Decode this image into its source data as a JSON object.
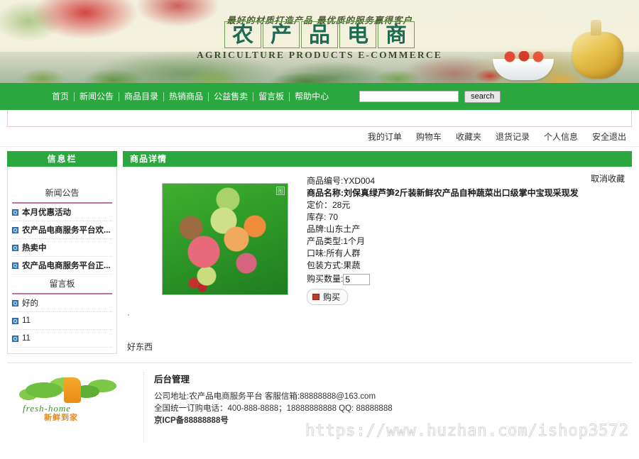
{
  "banner": {
    "slogan": "最好的材质打造产品  最优质的服务赢得客户",
    "title_chars": [
      "农",
      "产",
      "品",
      "电",
      "商"
    ],
    "subtitle": "AGRICULTURE PRODUCTS E-COMMERCE"
  },
  "nav": {
    "items": [
      {
        "label": "首页"
      },
      {
        "label": "新闻公告"
      },
      {
        "label": "商品目录"
      },
      {
        "label": "热销商品"
      },
      {
        "label": "公益售卖"
      },
      {
        "label": "留言板"
      },
      {
        "label": "帮助中心"
      }
    ],
    "search": {
      "value": "",
      "placeholder": "",
      "button_label": "search"
    }
  },
  "usermenu": {
    "items": [
      {
        "label": "我的订单"
      },
      {
        "label": "购物车"
      },
      {
        "label": "收藏夹"
      },
      {
        "label": "退货记录"
      },
      {
        "label": "个人信息"
      },
      {
        "label": "安全退出"
      }
    ]
  },
  "sidebar": {
    "header": "信息栏",
    "sections": [
      {
        "title": "新闻公告",
        "items": [
          {
            "label": "本月优惠活动",
            "icon": "bullet-icon"
          },
          {
            "label": "农产品电商服务平台欢...",
            "icon": "bullet-icon"
          },
          {
            "label": "热卖中",
            "icon": "bullet-icon"
          },
          {
            "label": "农产品电商服务平台正...",
            "icon": "bullet-icon"
          }
        ]
      },
      {
        "title": "留言板",
        "items": [
          {
            "label": "好的",
            "icon": "bullet-icon"
          },
          {
            "label": "11",
            "icon": "bullet-icon"
          },
          {
            "label": "11",
            "icon": "bullet-icon"
          }
        ]
      }
    ]
  },
  "content": {
    "header": "商品详情",
    "favorite_link": "取消收藏",
    "product": {
      "id_line": "商品编号:YXD004",
      "name_line": "商品名称:刘保真绿芦笋2斤装新鲜农产品自种蔬菜出口级掌中宝现采现发",
      "price_line": "定价：28元",
      "stock_line": "库存: 70",
      "brand_line": "品牌:山东土产",
      "type_line": "产品类型:1个月",
      "taste_line": "口味:所有人群",
      "package_line": "包装方式:果蔬",
      "qty_label": "购买数量:",
      "qty_value": "5",
      "buy_label": "购买",
      "image_badge": "图",
      "bullet": "·",
      "description": "好东西"
    }
  },
  "footer": {
    "logo": {
      "en": "fresh-home",
      "cn": "新鲜到家"
    },
    "title": "后台管理",
    "lines": [
      "公司地址:农产品电商服务平台   客服信箱:88888888@163.com",
      "全国统一订购电话：400-888-8888；18888888888  QQ: 88888888"
    ],
    "icp": "京ICP备88888888号",
    "watermark": "https://www.huzhan.com/ishop3572"
  },
  "colors": {
    "green": "#2aa83f",
    "pink": "#c8729b",
    "blue_bullet": "#3b7fc4",
    "red": "#c0392b"
  }
}
